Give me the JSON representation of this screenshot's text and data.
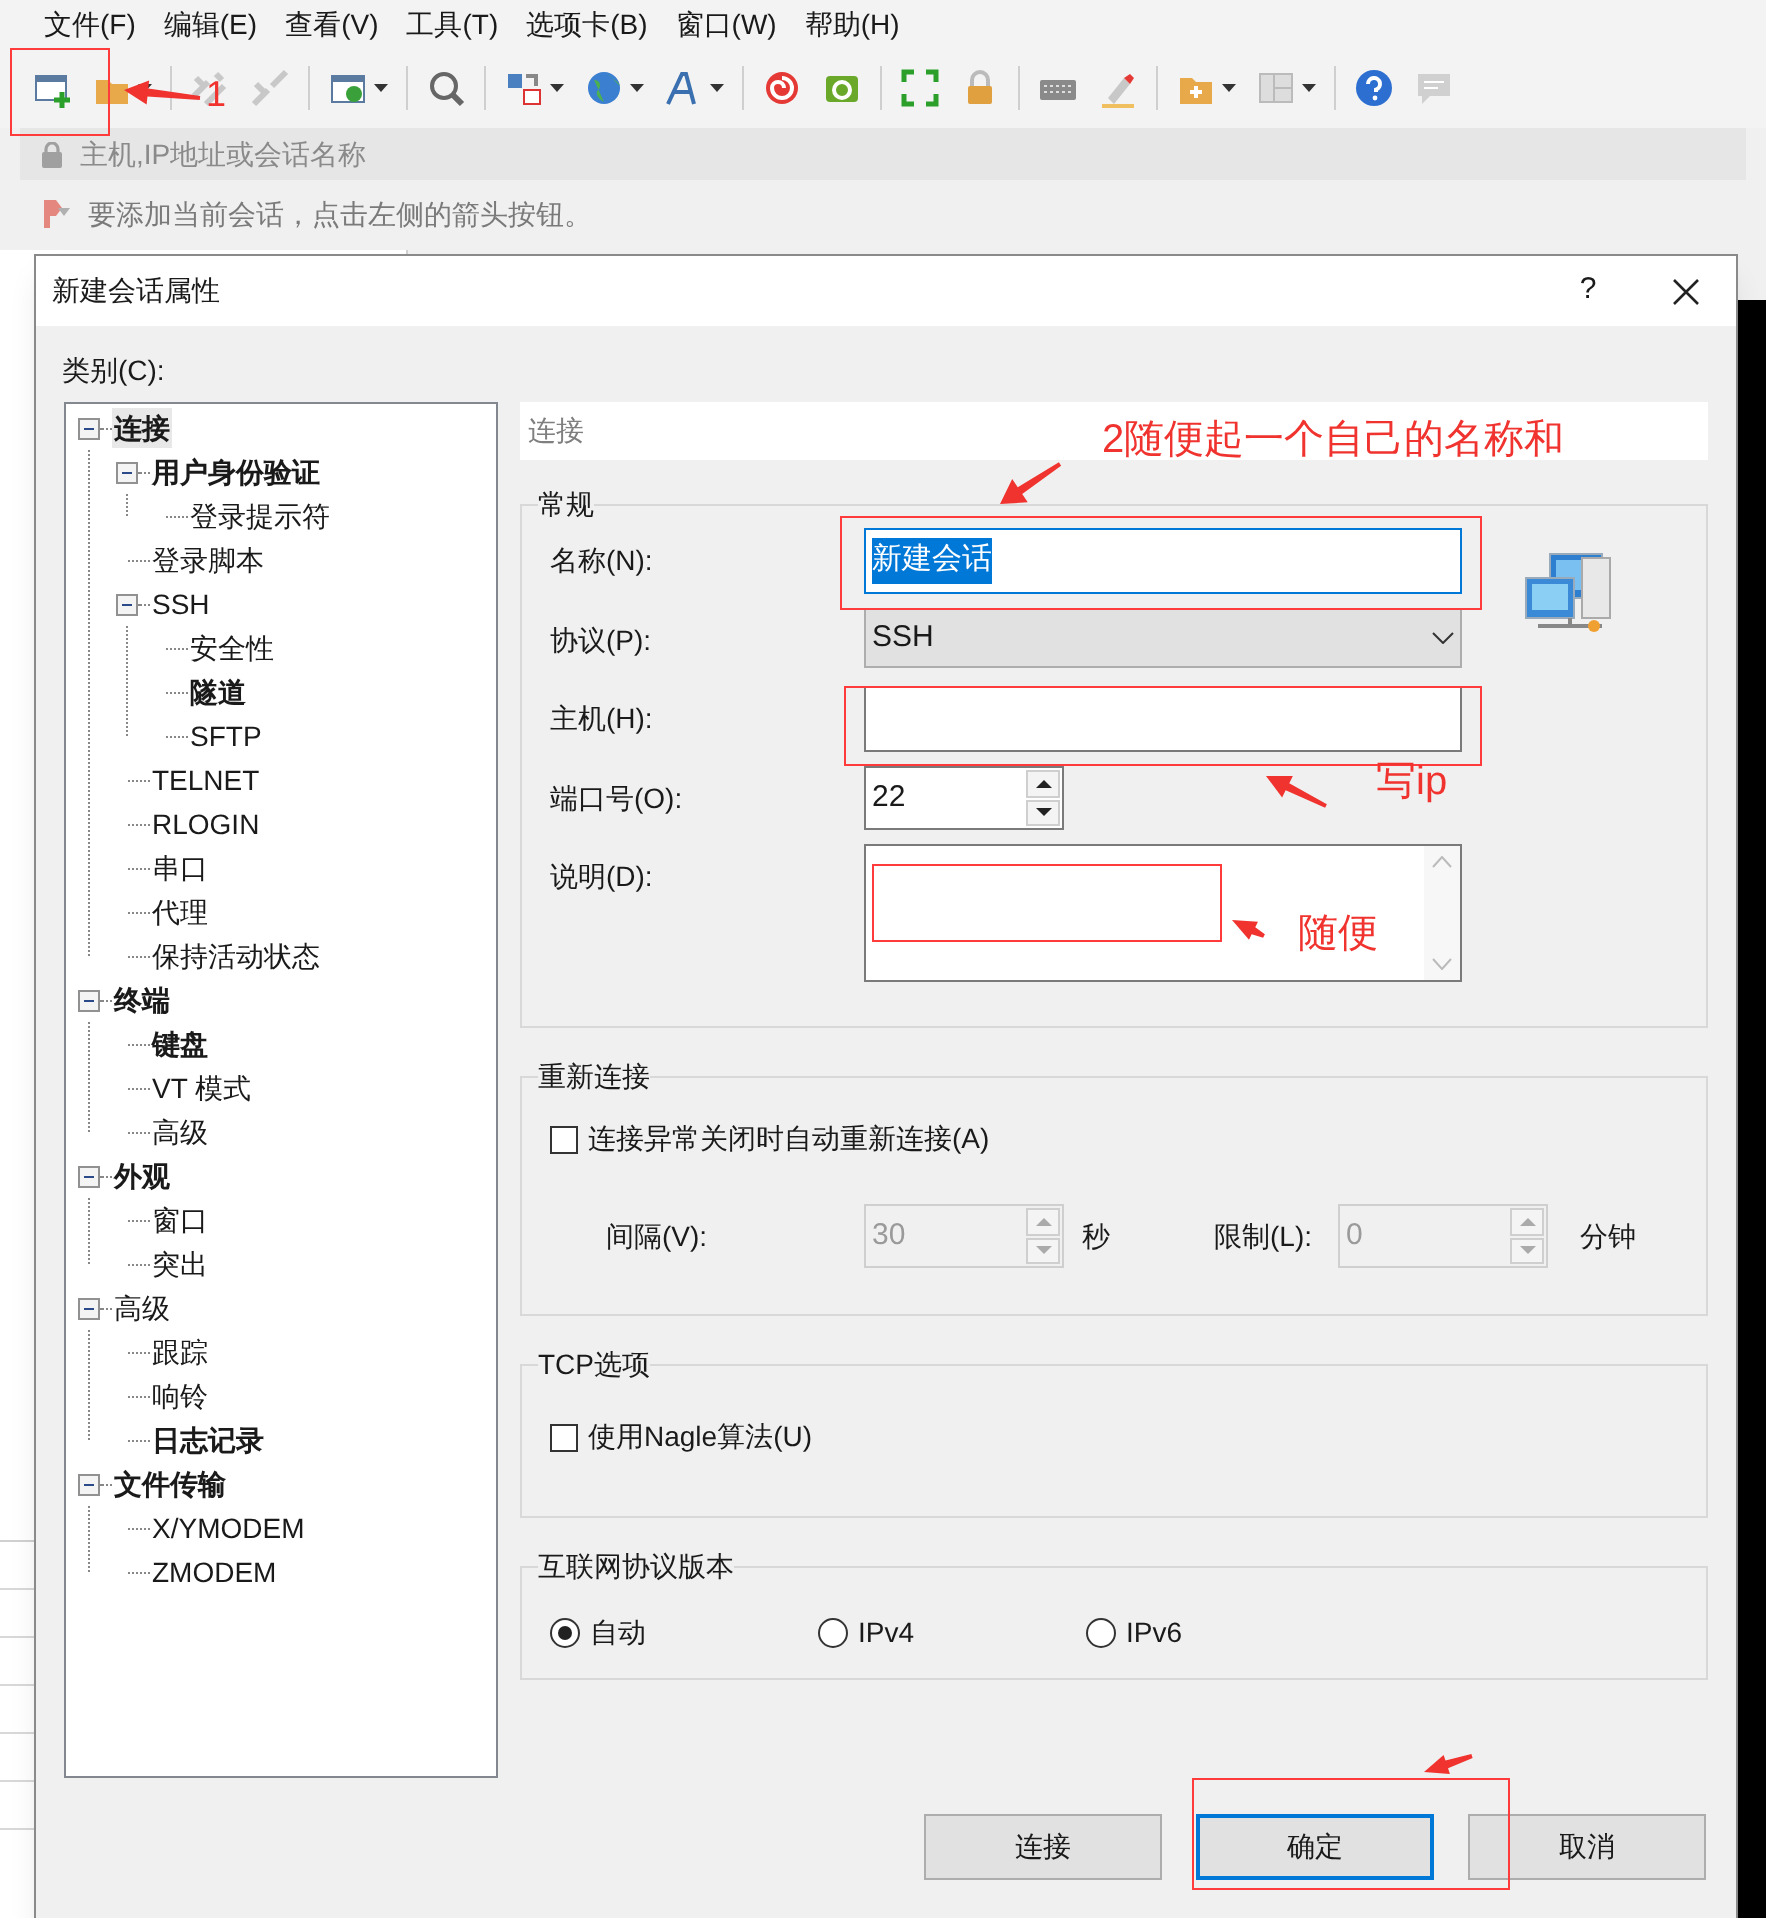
{
  "menu": [
    "文件(F)",
    "编辑(E)",
    "查看(V)",
    "工具(T)",
    "选项卡(B)",
    "窗口(W)",
    "帮助(H)"
  ],
  "address_bar": {
    "placeholder": "主机,IP地址或会话名称"
  },
  "hint_bar": {
    "text": "要添加当前会话，点击左侧的箭头按钮。"
  },
  "dialog": {
    "title": "新建会话属性",
    "help": "?",
    "category_label": "类别(C):",
    "tree": [
      {
        "label": "连接",
        "bold": true,
        "selected": true,
        "expanded": true,
        "children": [
          {
            "label": "用户身份验证",
            "bold": true,
            "selected": false,
            "expanded": true,
            "children": [
              {
                "label": "登录提示符",
                "bold": false,
                "selected": false
              }
            ]
          },
          {
            "label": "登录脚本",
            "bold": false,
            "selected": false
          },
          {
            "label": "SSH",
            "bold": false,
            "selected": false,
            "expanded": true,
            "children": [
              {
                "label": "安全性",
                "bold": false,
                "selected": false
              },
              {
                "label": "隧道",
                "bold": true,
                "selected": false
              },
              {
                "label": "SFTP",
                "bold": false,
                "selected": false
              }
            ]
          },
          {
            "label": "TELNET",
            "bold": false,
            "selected": false
          },
          {
            "label": "RLOGIN",
            "bold": false,
            "selected": false
          },
          {
            "label": "串口",
            "bold": false,
            "selected": false
          },
          {
            "label": "代理",
            "bold": false,
            "selected": false
          },
          {
            "label": "保持活动状态",
            "bold": false,
            "selected": false
          }
        ]
      },
      {
        "label": "终端",
        "bold": true,
        "selected": false,
        "expanded": true,
        "children": [
          {
            "label": "键盘",
            "bold": true,
            "selected": false
          },
          {
            "label": "VT 模式",
            "bold": false,
            "selected": false
          },
          {
            "label": "高级",
            "bold": false,
            "selected": false
          }
        ]
      },
      {
        "label": "外观",
        "bold": true,
        "selected": false,
        "expanded": true,
        "children": [
          {
            "label": "窗口",
            "bold": false,
            "selected": false
          },
          {
            "label": "突出",
            "bold": false,
            "selected": false
          }
        ]
      },
      {
        "label": "高级",
        "bold": false,
        "selected": false,
        "expanded": true,
        "children": [
          {
            "label": "跟踪",
            "bold": false,
            "selected": false
          },
          {
            "label": "响铃",
            "bold": false,
            "selected": false
          },
          {
            "label": "日志记录",
            "bold": true,
            "selected": false
          }
        ]
      },
      {
        "label": "文件传输",
        "bold": true,
        "selected": false,
        "expanded": true,
        "children": [
          {
            "label": "X/YMODEM",
            "bold": false,
            "selected": false
          },
          {
            "label": "ZMODEM",
            "bold": false,
            "selected": false
          }
        ]
      }
    ],
    "panel_header": "连接",
    "general": {
      "title": "常规",
      "fields": [
        {
          "kind": "text",
          "label": "名称(N):",
          "value": "新建会话",
          "focused": true
        },
        {
          "kind": "select",
          "label": "协议(P):",
          "value": "SSH"
        },
        {
          "kind": "text",
          "label": "主机(H):",
          "focused": false
        },
        {
          "kind": "spinner",
          "label": "端口号(O):",
          "value": "22"
        },
        {
          "kind": "textarea",
          "label": "说明(D):"
        }
      ]
    },
    "reconnect": {
      "title": "重新连接",
      "checkbox": {
        "label": "连接异常关闭时自动重新连接(A)",
        "checked": false
      },
      "spinners": [
        {
          "label": "间隔(V):",
          "value": "30",
          "unit": "秒",
          "disabled": true
        },
        {
          "label": "限制(L):",
          "value": "0",
          "unit": "分钟",
          "disabled": true
        }
      ]
    },
    "tcp": {
      "title": "TCP选项",
      "checkbox": {
        "label": "使用Nagle算法(U)",
        "checked": false
      }
    },
    "ip_version": {
      "title": "互联网协议版本",
      "options": [
        {
          "label": "自动",
          "selected": true
        },
        {
          "label": "IPv4",
          "selected": false
        },
        {
          "label": "IPv6",
          "selected": false
        }
      ]
    },
    "buttons": [
      {
        "label": "连接",
        "default": false
      },
      {
        "label": "确定",
        "default": true
      },
      {
        "label": "取消",
        "default": false
      }
    ]
  },
  "annotations": {
    "labels": [
      "1",
      "2随便起一个自己的名称和",
      "写ip",
      "随便"
    ]
  }
}
